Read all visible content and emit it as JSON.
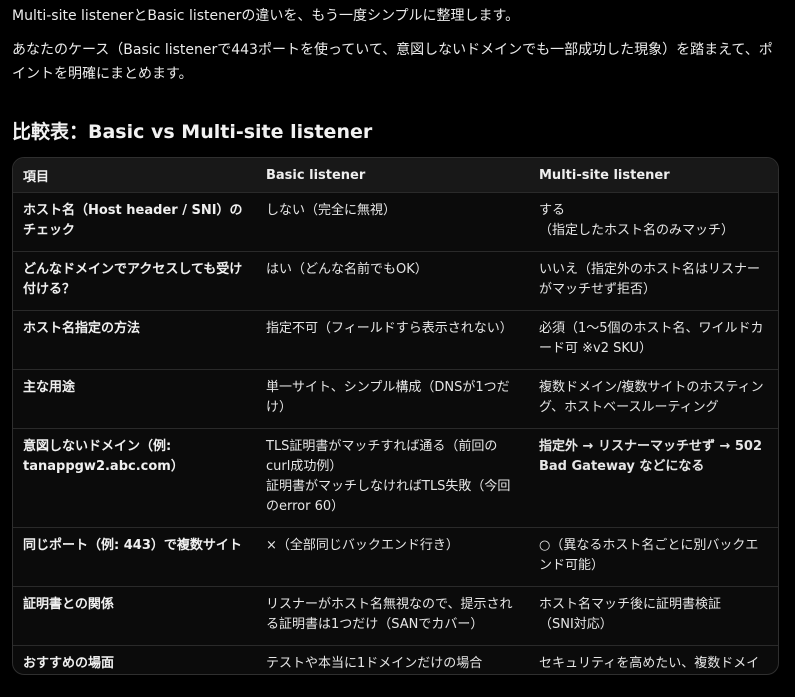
{
  "intro": {
    "line1": "Multi-site listenerとBasic listenerの違いを、もう一度シンプルに整理します。",
    "line2": "あなたのケース（Basic listenerで443ポートを使っていて、意図しないドメインでも一部成功した現象）を踏まえて、ポイントを明確にまとめます。"
  },
  "heading": "比較表：Basic vs Multi-site listener",
  "table": {
    "headers": [
      "項目",
      "Basic listener",
      "Multi-site listener"
    ],
    "rows": [
      {
        "item": "ホスト名（Host header / SNI）のチェック",
        "basic": "しない（完全に無視）",
        "multi": "する\n（指定したホスト名のみマッチ）"
      },
      {
        "item": "どんなドメインでアクセスしても受け付ける？",
        "basic": "はい（どんな名前でもOK）",
        "multi": "いいえ（指定外のホスト名はリスナーがマッチせず拒否）"
      },
      {
        "item": "ホスト名指定の方法",
        "basic": "指定不可（フィールドすら表示されない）",
        "multi": "必須（1〜5個のホスト名、ワイルドカード可 ※v2 SKU）"
      },
      {
        "item": "主な用途",
        "basic": "単一サイト、シンプル構成（DNSが1つだけ）",
        "multi": "複数ドメイン/複数サイトのホスティング、ホストベースルーティング"
      },
      {
        "item": "意図しないドメイン（例: tanappgw2.abc.com）",
        "basic": "TLS証明書がマッチすれば通る（前回のcurl成功例）\n証明書がマッチしなければTLS失敗（今回のerror 60）",
        "multi": "指定外 → リスナーマッチせず → 502 Bad Gateway などになる"
      },
      {
        "item": "同じポート（例: 443）で複数サイト",
        "basic": "×（全部同じバックエンド行き）",
        "multi": "○（異なるホスト名ごとに別バックエンド可能）"
      },
      {
        "item": "証明書との関係",
        "basic": "リスナーがホスト名無視なので、提示される証明書は1つだけ（SANでカバー）",
        "multi": "ホスト名マッチ後に証明書検証\n（SNI対応）"
      },
      {
        "item": "おすすめの場面",
        "basic": "テストや本当に1ドメインだけの場合",
        "multi": "セキュリティを高めたい、複数ドメイン運用する場合"
      }
    ]
  }
}
